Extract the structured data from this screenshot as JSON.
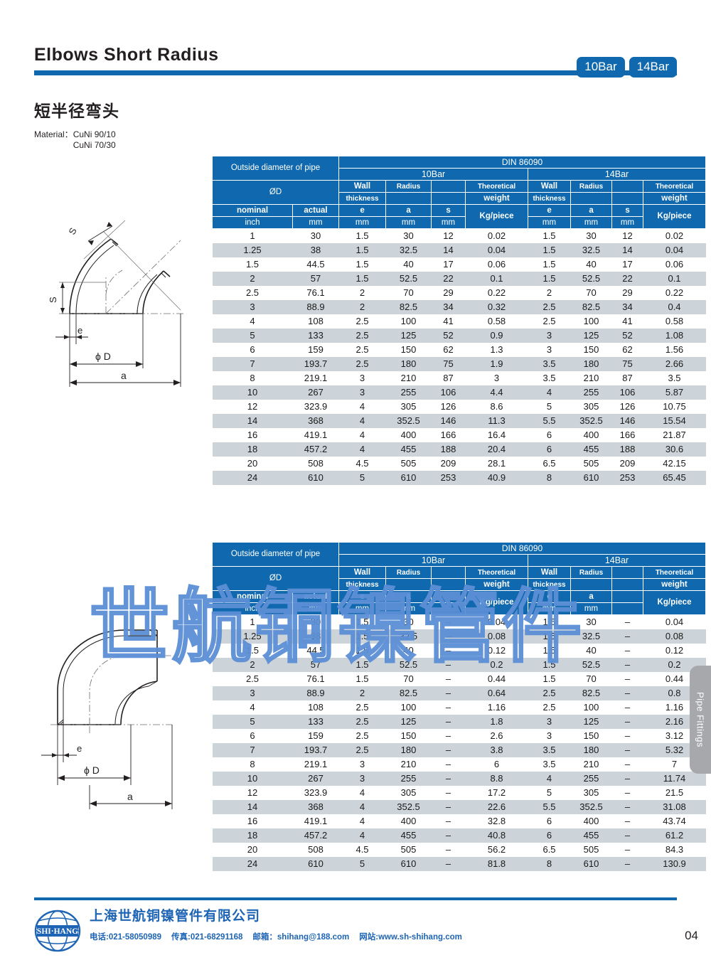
{
  "header": {
    "title": "Elbows Short Radius",
    "badges": [
      "10Bar",
      "14Bar"
    ]
  },
  "subtitle": {
    "title_cn": "短半径弯头",
    "material_label": "Material：",
    "material_values": [
      "CuNi 90/10",
      "CuNi 70/30"
    ]
  },
  "watermark": {
    "text": "世航铜镍管件"
  },
  "side_tab": {
    "label": "Pipe Fittings"
  },
  "page_number": "04",
  "drawing_45": {
    "labels": {
      "s_upper": "S",
      "s_left": "S",
      "e": "e",
      "diameter": "ϕ D",
      "a": "a"
    }
  },
  "drawing_90": {
    "labels": {
      "e": "e",
      "diameter": "ϕ D",
      "a": "a"
    }
  },
  "footer": {
    "company": "上海世航铜镍管件有限公司",
    "phone": "电话:021-58050989",
    "fax": "传真:021-68291168",
    "email": "邮箱：shihang@188.com",
    "website": "网站:www.sh-shihang.com",
    "logo_text": "SHI-HANG"
  },
  "table_headers": {
    "outside_diameter": "Outside diameter of pipe",
    "od_symbol": "ØD",
    "standard": "DIN 86090",
    "bar_10": "10Bar",
    "bar_14": "14Bar",
    "wall": "Wall",
    "thickness": "thickness",
    "radius": "Radius",
    "theoretical": "Theoretical",
    "weight": "weight",
    "nominal": "nominal",
    "actual": "actual",
    "inch": "inch",
    "mm": "mm",
    "sym_e": "e",
    "sym_a": "a",
    "sym_s": "s",
    "kg_piece": "Kg/piece",
    "blank": ""
  },
  "table_1": {
    "columns": [
      "nominal_inch",
      "actual_mm",
      "e10_mm",
      "a10_mm",
      "s10_mm",
      "w10_kg",
      "e14_mm",
      "a14_mm",
      "s14_mm",
      "w14_kg"
    ],
    "rows": [
      [
        "1",
        "30",
        "1.5",
        "30",
        "12",
        "0.02",
        "1.5",
        "30",
        "12",
        "0.02"
      ],
      [
        "1.25",
        "38",
        "1.5",
        "32.5",
        "14",
        "0.04",
        "1.5",
        "32.5",
        "14",
        "0.04"
      ],
      [
        "1.5",
        "44.5",
        "1.5",
        "40",
        "17",
        "0.06",
        "1.5",
        "40",
        "17",
        "0.06"
      ],
      [
        "2",
        "57",
        "1.5",
        "52.5",
        "22",
        "0.1",
        "1.5",
        "52.5",
        "22",
        "0.1"
      ],
      [
        "2.5",
        "76.1",
        "2",
        "70",
        "29",
        "0.22",
        "2",
        "70",
        "29",
        "0.22"
      ],
      [
        "3",
        "88.9",
        "2",
        "82.5",
        "34",
        "0.32",
        "2.5",
        "82.5",
        "34",
        "0.4"
      ],
      [
        "4",
        "108",
        "2.5",
        "100",
        "41",
        "0.58",
        "2.5",
        "100",
        "41",
        "0.58"
      ],
      [
        "5",
        "133",
        "2.5",
        "125",
        "52",
        "0.9",
        "3",
        "125",
        "52",
        "1.08"
      ],
      [
        "6",
        "159",
        "2.5",
        "150",
        "62",
        "1.3",
        "3",
        "150",
        "62",
        "1.56"
      ],
      [
        "7",
        "193.7",
        "2.5",
        "180",
        "75",
        "1.9",
        "3.5",
        "180",
        "75",
        "2.66"
      ],
      [
        "8",
        "219.1",
        "3",
        "210",
        "87",
        "3",
        "3.5",
        "210",
        "87",
        "3.5"
      ],
      [
        "10",
        "267",
        "3",
        "255",
        "106",
        "4.4",
        "4",
        "255",
        "106",
        "5.87"
      ],
      [
        "12",
        "323.9",
        "4",
        "305",
        "126",
        "8.6",
        "5",
        "305",
        "126",
        "10.75"
      ],
      [
        "14",
        "368",
        "4",
        "352.5",
        "146",
        "11.3",
        "5.5",
        "352.5",
        "146",
        "15.54"
      ],
      [
        "16",
        "419.1",
        "4",
        "400",
        "166",
        "16.4",
        "6",
        "400",
        "166",
        "21.87"
      ],
      [
        "18",
        "457.2",
        "4",
        "455",
        "188",
        "20.4",
        "6",
        "455",
        "188",
        "30.6"
      ],
      [
        "20",
        "508",
        "4.5",
        "505",
        "209",
        "28.1",
        "6.5",
        "505",
        "209",
        "42.15"
      ],
      [
        "24",
        "610",
        "5",
        "610",
        "253",
        "40.9",
        "8",
        "610",
        "253",
        "65.45"
      ]
    ]
  },
  "table_2": {
    "columns": [
      "nominal_inch",
      "actual_mm",
      "e10_mm",
      "a10_mm",
      "s10_mm",
      "w10_kg",
      "e14_mm",
      "a14_mm",
      "s14_mm",
      "w14_kg"
    ],
    "rows": [
      [
        "1",
        "30",
        "1.5",
        "30",
        "–",
        "0.04",
        "1.5",
        "30",
        "–",
        "0.04"
      ],
      [
        "1.25",
        "38",
        "1.5",
        "32.5",
        "–",
        "0.08",
        "1.5",
        "32.5",
        "–",
        "0.08"
      ],
      [
        "1.5",
        "44.5",
        "1.5",
        "40",
        "–",
        "0.12",
        "1.5",
        "40",
        "–",
        "0.12"
      ],
      [
        "2",
        "57",
        "1.5",
        "52.5",
        "–",
        "0.2",
        "1.5",
        "52.5",
        "–",
        "0.2"
      ],
      [
        "2.5",
        "76.1",
        "1.5",
        "70",
        "–",
        "0.44",
        "1.5",
        "70",
        "–",
        "0.44"
      ],
      [
        "3",
        "88.9",
        "2",
        "82.5",
        "–",
        "0.64",
        "2.5",
        "82.5",
        "–",
        "0.8"
      ],
      [
        "4",
        "108",
        "2.5",
        "100",
        "–",
        "1.16",
        "2.5",
        "100",
        "–",
        "1.16"
      ],
      [
        "5",
        "133",
        "2.5",
        "125",
        "–",
        "1.8",
        "3",
        "125",
        "–",
        "2.16"
      ],
      [
        "6",
        "159",
        "2.5",
        "150",
        "–",
        "2.6",
        "3",
        "150",
        "–",
        "3.12"
      ],
      [
        "7",
        "193.7",
        "2.5",
        "180",
        "–",
        "3.8",
        "3.5",
        "180",
        "–",
        "5.32"
      ],
      [
        "8",
        "219.1",
        "3",
        "210",
        "–",
        "6",
        "3.5",
        "210",
        "–",
        "7"
      ],
      [
        "10",
        "267",
        "3",
        "255",
        "–",
        "8.8",
        "4",
        "255",
        "–",
        "11.74"
      ],
      [
        "12",
        "323.9",
        "4",
        "305",
        "–",
        "17.2",
        "5",
        "305",
        "–",
        "21.5"
      ],
      [
        "14",
        "368",
        "4",
        "352.5",
        "–",
        "22.6",
        "5.5",
        "352.5",
        "–",
        "31.08"
      ],
      [
        "16",
        "419.1",
        "4",
        "400",
        "–",
        "32.8",
        "6",
        "400",
        "–",
        "43.74"
      ],
      [
        "18",
        "457.2",
        "4",
        "455",
        "–",
        "40.8",
        "6",
        "455",
        "–",
        "61.2"
      ],
      [
        "20",
        "508",
        "4.5",
        "505",
        "–",
        "56.2",
        "6.5",
        "505",
        "–",
        "84.3"
      ],
      [
        "24",
        "610",
        "5",
        "610",
        "–",
        "81.8",
        "8",
        "610",
        "–",
        "130.9"
      ]
    ]
  },
  "colors": {
    "brand_blue": "#1069ae",
    "row_alt": "#ccd4d9",
    "side_tab_gray": "#a6a8ab",
    "footer_blue": "#1e64b4",
    "watermark_blue": "#5c8fd6"
  }
}
